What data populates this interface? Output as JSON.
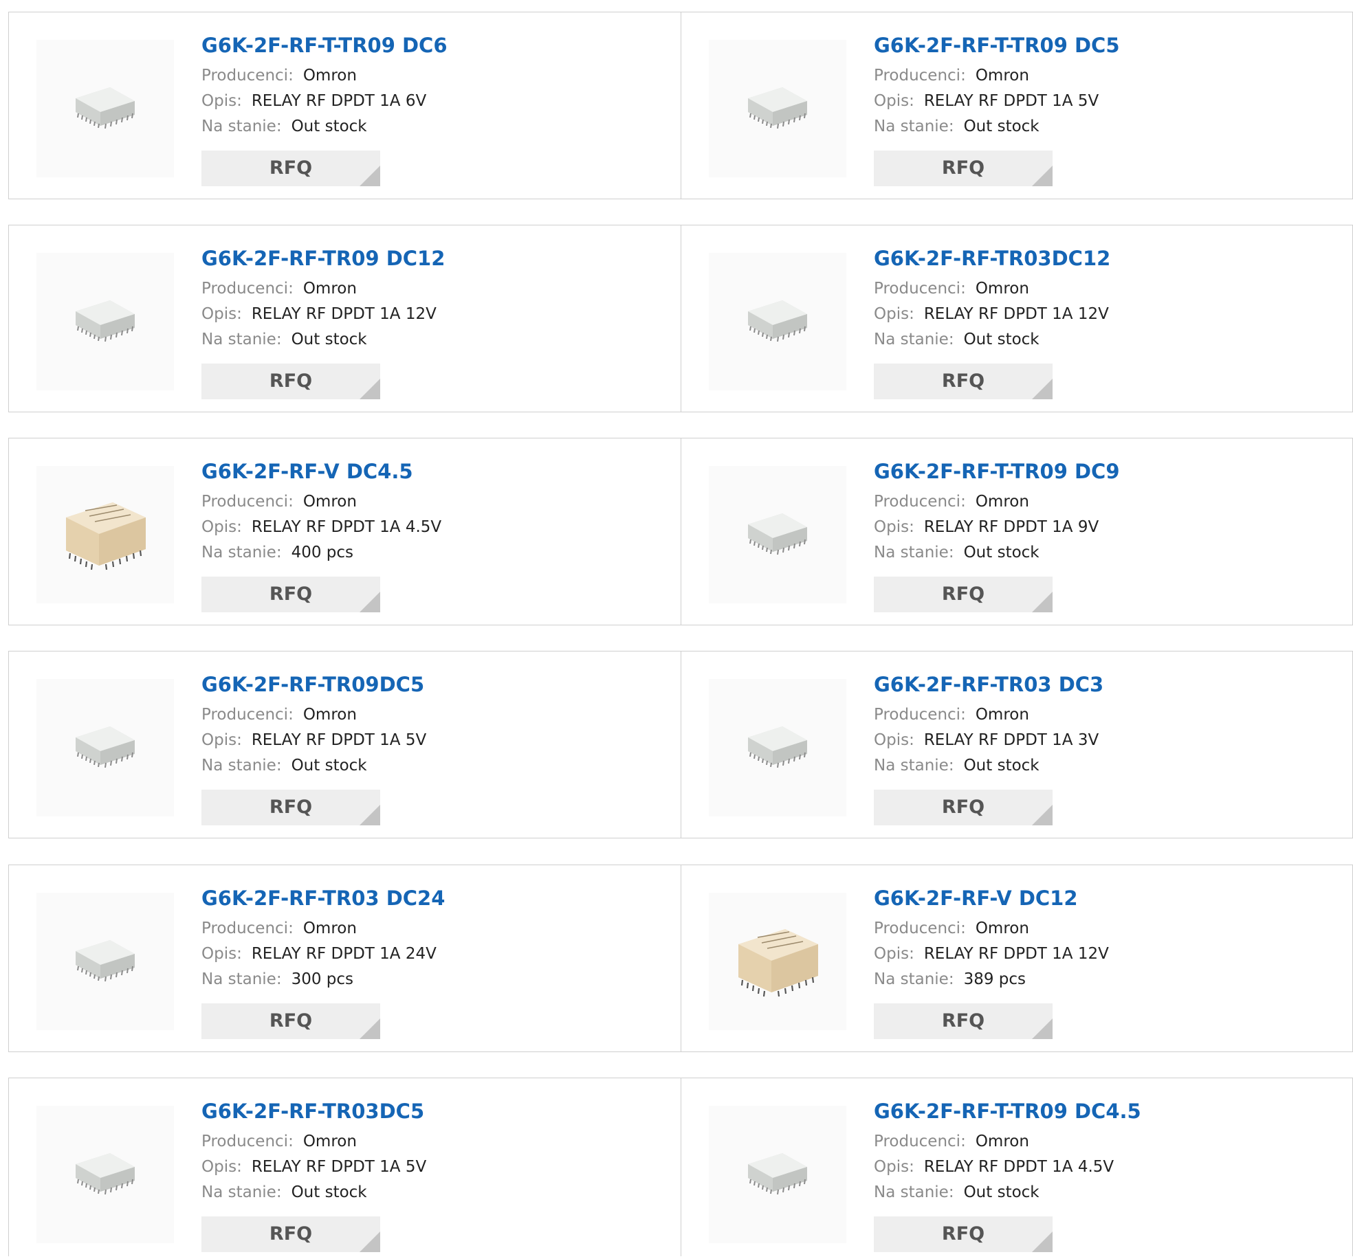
{
  "labels": {
    "manufacturer": "Producenci:",
    "description": "Opis:",
    "stock": "Na stanie:",
    "rfq": "RFQ"
  },
  "products": [
    {
      "part": "G6K-2F-RF-T-TR09 DC6",
      "manufacturer": "Omron",
      "description": "RELAY RF DPDT 1A 6V",
      "stock": "Out stock",
      "image": "gray-relay"
    },
    {
      "part": "G6K-2F-RF-T-TR09 DC5",
      "manufacturer": "Omron",
      "description": "RELAY RF DPDT 1A 5V",
      "stock": "Out stock",
      "image": "gray-relay"
    },
    {
      "part": "G6K-2F-RF-TR09 DC12",
      "manufacturer": "Omron",
      "description": "RELAY RF DPDT 1A 12V",
      "stock": "Out stock",
      "image": "gray-relay"
    },
    {
      "part": "G6K-2F-RF-TR03DC12",
      "manufacturer": "Omron",
      "description": "RELAY RF DPDT 1A 12V",
      "stock": "Out stock",
      "image": "gray-relay"
    },
    {
      "part": "G6K-2F-RF-V DC4.5",
      "manufacturer": "Omron",
      "description": "RELAY RF DPDT 1A 4.5V",
      "stock": "400 pcs",
      "image": "beige-relay"
    },
    {
      "part": "G6K-2F-RF-T-TR09 DC9",
      "manufacturer": "Omron",
      "description": "RELAY RF DPDT 1A 9V",
      "stock": "Out stock",
      "image": "gray-relay"
    },
    {
      "part": "G6K-2F-RF-TR09DC5",
      "manufacturer": "Omron",
      "description": "RELAY RF DPDT 1A 5V",
      "stock": "Out stock",
      "image": "gray-relay"
    },
    {
      "part": "G6K-2F-RF-TR03 DC3",
      "manufacturer": "Omron",
      "description": "RELAY RF DPDT 1A 3V",
      "stock": "Out stock",
      "image": "gray-relay"
    },
    {
      "part": "G6K-2F-RF-TR03 DC24",
      "manufacturer": "Omron",
      "description": "RELAY RF DPDT 1A 24V",
      "stock": "300 pcs",
      "image": "gray-relay"
    },
    {
      "part": "G6K-2F-RF-V DC12",
      "manufacturer": "Omron",
      "description": "RELAY RF DPDT 1A 12V",
      "stock": "389 pcs",
      "image": "beige-relay"
    },
    {
      "part": "G6K-2F-RF-TR03DC5",
      "manufacturer": "Omron",
      "description": "RELAY RF DPDT 1A 5V",
      "stock": "Out stock",
      "image": "gray-relay"
    },
    {
      "part": "G6K-2F-RF-T-TR09 DC4.5",
      "manufacturer": "Omron",
      "description": "RELAY RF DPDT 1A 4.5V",
      "stock": "Out stock",
      "image": "gray-relay"
    }
  ]
}
